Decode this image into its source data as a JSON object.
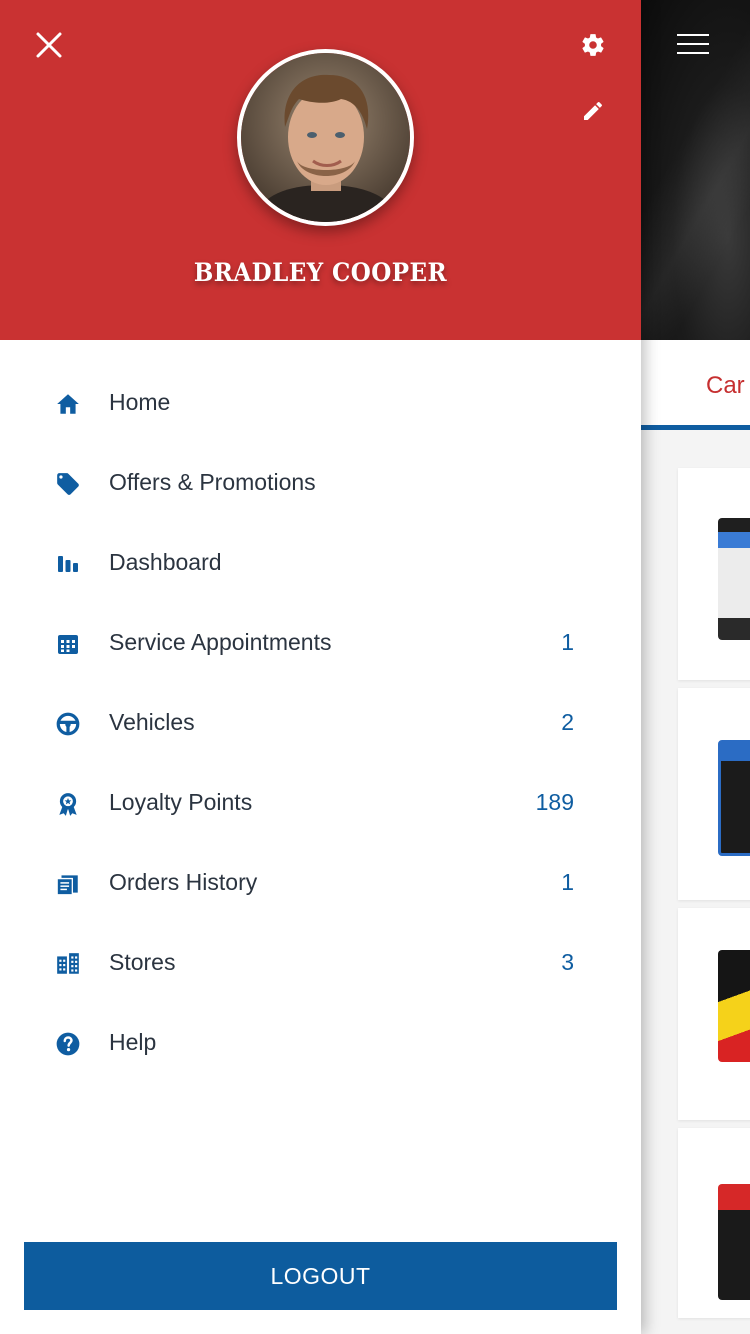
{
  "user": {
    "name": "BRADLEY COOPER"
  },
  "header": {
    "close_icon": "close-icon",
    "settings_icon": "gear-icon",
    "edit_icon": "pencil-icon"
  },
  "menu": {
    "items": [
      {
        "label": "Home",
        "count": "",
        "icon": "home-icon"
      },
      {
        "label": "Offers & Promotions",
        "count": "",
        "icon": "tag-icon"
      },
      {
        "label": "Dashboard",
        "count": "",
        "icon": "bar-chart-icon"
      },
      {
        "label": "Service Appointments",
        "count": "1",
        "icon": "calendar-icon"
      },
      {
        "label": "Vehicles",
        "count": "2",
        "icon": "steering-wheel-icon"
      },
      {
        "label": "Loyalty Points",
        "count": "189",
        "icon": "award-icon"
      },
      {
        "label": "Orders History",
        "count": "1",
        "icon": "receipt-icon"
      },
      {
        "label": "Stores",
        "count": "3",
        "icon": "building-icon"
      },
      {
        "label": "Help",
        "count": "",
        "icon": "help-icon"
      }
    ]
  },
  "logout": {
    "label": "LOGOUT"
  },
  "background_screen": {
    "tab_label": "Car B",
    "menu_icon": "hamburger-icon"
  },
  "colors": {
    "header_red": "#c93232",
    "accent_blue": "#0f5da1",
    "logout_blue": "#0d5c9e",
    "text_dark": "#2b3440",
    "tab_red": "#c62f30"
  }
}
